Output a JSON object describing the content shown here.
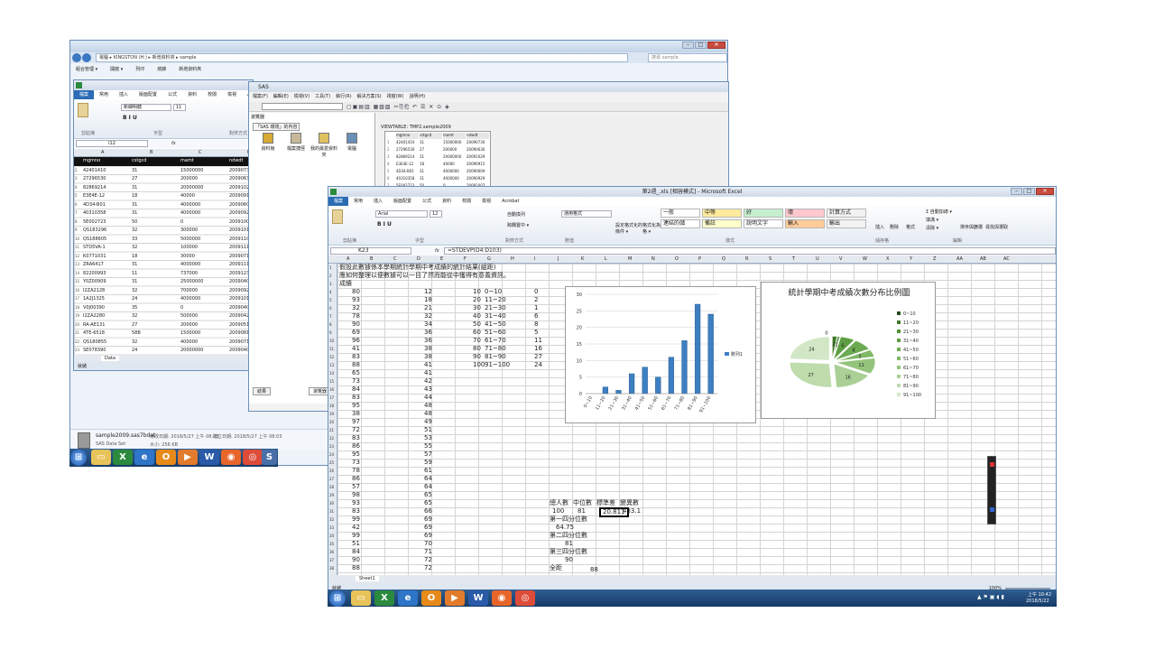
{
  "explorer": {
    "address": "電腦 ▸ KINGSTON (H:) ▸ 新增資料夾 ▸ sample",
    "search_placeholder": "搜尋 sample",
    "toolbar": [
      "組合管理 ▾",
      "開啟 ▾",
      "列印",
      "燒錄",
      "新增資料夾"
    ],
    "file": {
      "name": "sample2009.sas7bdat",
      "modified": "修改日期: 2018/5/27 上午 08:03",
      "created": "建立日期: 2018/5/27 上午 08:03",
      "type": "SAS Data Set",
      "size": "大小: 256 KB"
    }
  },
  "excel1": {
    "tabs": [
      "檔案",
      "常用",
      "插入",
      "版面配置",
      "公式",
      "資料",
      "校閱",
      "檢視",
      "Acrobat"
    ],
    "font": "新細明體",
    "size": "11",
    "cellref": "I12",
    "groups": [
      "剪貼簿",
      "字型",
      "對齊方式"
    ],
    "headers": [
      "mgmno",
      "cstgcd",
      "mamt",
      "ndwdt"
    ],
    "cols": [
      "A",
      "B",
      "C",
      "D"
    ],
    "rows": [
      [
        "42401410",
        "31",
        "15000000",
        "20090730"
      ],
      [
        "27296530",
        "27",
        "200000",
        "20090630"
      ],
      [
        "82869214",
        "31",
        "20000000",
        "20091029"
      ],
      [
        "E3E4E-12",
        "18",
        "40000",
        "20090915"
      ],
      [
        "4D34-B01",
        "31",
        "4000000",
        "20090609"
      ],
      [
        "40310358",
        "31",
        "4000000",
        "20090929"
      ],
      [
        "5E002723",
        "50",
        "0",
        "20091007"
      ],
      [
        "QS183296",
        "32",
        "300000",
        "20091012"
      ],
      [
        "QS188605",
        "33",
        "5000000",
        "20091102"
      ],
      [
        "STD5VA-1",
        "32",
        "100000",
        "20091111"
      ],
      [
        "K0771031",
        "18",
        "30000",
        "20090716"
      ],
      [
        "ZRA6417",
        "31",
        "4000000",
        "20091117"
      ],
      [
        "82200993",
        "11",
        "737000",
        "20091231"
      ],
      [
        "Y0Z00909",
        "31",
        "25000000",
        "20090403"
      ],
      [
        "I2ZA2128",
        "32",
        "700000",
        "20090928"
      ],
      [
        "1A2J1325",
        "24",
        "4000000",
        "20091014"
      ],
      [
        "V0J00390",
        "35",
        "0",
        "20090402"
      ],
      [
        "I2ZA2280",
        "32",
        "500000",
        "20090423"
      ],
      [
        "RA-AE131",
        "27",
        "200000",
        "20090515"
      ],
      [
        "4TE-6518",
        "58B",
        "1500000",
        "20090812"
      ],
      [
        "QS180855",
        "32",
        "400000",
        "20090716"
      ],
      [
        "SE078390",
        "24",
        "20000000",
        "20090402"
      ],
      [
        "CO130950",
        "31",
        "0",
        "20090514"
      ]
    ],
    "sheet": "Data",
    "status": "就緒"
  },
  "sas": {
    "title": "SAS",
    "menus": [
      "檔案(F)",
      "編輯(E)",
      "檢視(V)",
      "工具(T)",
      "執行(R)",
      "解決方案(S)",
      "視窗(W)",
      "說明(H)"
    ],
    "explorer_title": "瀏覽器",
    "explorer_sub": "「SAS 環境」的內容",
    "icons": [
      "資料館",
      "檔案捷徑",
      "我的最愛資料夾",
      "電腦"
    ],
    "viewtable": "VIEWTABLE: TMP2.sample2009",
    "vt_headers": [
      "mgmno",
      "cstgcd",
      "mamt",
      "ndwdt"
    ],
    "vt_rows": [
      [
        "42401410",
        "31",
        "15000000",
        "20090730"
      ],
      [
        "27296530",
        "27",
        "200000",
        "20090630"
      ],
      [
        "82869214",
        "31",
        "20000000",
        "20091029"
      ],
      [
        "E3E4E-12",
        "18",
        "40000",
        "20090915"
      ],
      [
        "4D34-B01",
        "31",
        "4000000",
        "20090609"
      ],
      [
        "40310358",
        "31",
        "4000000",
        "20090929"
      ],
      [
        "5E002723",
        "50",
        "0",
        "20091007"
      ]
    ],
    "results_tab": "結果",
    "explorer_tab": "瀏覽器"
  },
  "excel2": {
    "title": "第2週_.xls [相容模式] - Microsoft Excel",
    "tabs": [
      "檔案",
      "常用",
      "插入",
      "版面配置",
      "公式",
      "資料",
      "校閱",
      "檢視",
      "Acrobat"
    ],
    "font": "Arial",
    "size": "12",
    "cellref": "K23",
    "formula": "=STDEVP(D4:D103)",
    "wrap": "自動換列",
    "merge": "跨欄置中 ▾",
    "numfmt": "通用格式",
    "styles": [
      "一般",
      "中等",
      "好",
      "壞",
      "計算方式",
      "連結的儲",
      "備註",
      "說明文字",
      "輸入",
      "輸出"
    ],
    "styles_colors": [
      "#ffffff",
      "#ffeb9c",
      "#c6efce",
      "#ffc7ce",
      "#f2f2f2",
      "#ffffff",
      "#ffffcc",
      "#ffffff",
      "#ffcc99",
      "#f2f2f2"
    ],
    "groups": [
      "剪貼簿",
      "字型",
      "對齊方式",
      "數值",
      "樣式",
      "儲存格",
      "編輯"
    ],
    "cond": [
      "設定格式化的條件 ▾",
      "格式化為表格 ▾"
    ],
    "cells_btns": [
      "插入",
      "刪除",
      "格式"
    ],
    "edit_btns": [
      "Σ 自動加總 ▾",
      "填滿 ▾",
      "清除 ▾"
    ],
    "sort": "排序與篩選",
    "find": "尋找與選取",
    "cols": [
      "A",
      "B",
      "C",
      "D",
      "E",
      "F",
      "G",
      "H",
      "I",
      "J",
      "K",
      "L",
      "M",
      "N",
      "O",
      "P",
      "Q",
      "R",
      "S",
      "T",
      "U",
      "V",
      "W",
      "X",
      "Y",
      "Z",
      "AA",
      "AB",
      "AC"
    ],
    "line1": "假設此數據係本學期統計學期中考成績的統計結果(組距)",
    "line2": "應如何整理以便數據可以一目了然而能從中獲得有意義資訊。",
    "line3": "成績",
    "colA": [
      "80",
      "93",
      "32",
      "78",
      "90",
      "69",
      "96",
      "41",
      "83",
      "88",
      "65",
      "73",
      "84",
      "83",
      "95",
      "38",
      "97",
      "72",
      "83",
      "86",
      "95",
      "73",
      "78",
      "86",
      "57",
      "98",
      "93",
      "83",
      "99",
      "42",
      "99",
      "51",
      "84",
      "90",
      "88",
      "69"
    ],
    "colD": [
      "12",
      "18",
      "21",
      "32",
      "34",
      "36",
      "36",
      "38",
      "38",
      "41",
      "41",
      "42",
      "43",
      "44",
      "48",
      "48",
      "49",
      "51",
      "53",
      "55",
      "57",
      "59",
      "61",
      "64",
      "64",
      "65",
      "65",
      "66",
      "69",
      "69",
      "69",
      "70",
      "71",
      "72",
      "72",
      "73"
    ],
    "freq_table": [
      [
        "10",
        "0~10",
        "0"
      ],
      [
        "20",
        "11~20",
        "2"
      ],
      [
        "30",
        "21~30",
        "1"
      ],
      [
        "40",
        "31~40",
        "6"
      ],
      [
        "50",
        "41~50",
        "8"
      ],
      [
        "60",
        "51~60",
        "5"
      ],
      [
        "70",
        "61~70",
        "11"
      ],
      [
        "80",
        "71~80",
        "16"
      ],
      [
        "90",
        "81~90",
        "27"
      ],
      [
        "100",
        "91~100",
        "24"
      ]
    ],
    "stats_headers": [
      "總人數",
      "中位數",
      "標準差",
      "變異數"
    ],
    "stats_values": [
      "100",
      "81",
      "20.811",
      "433.1"
    ],
    "q1_label": "第一四分位數",
    "q1": "64.75",
    "q2_label": "第二四分位數",
    "q2": "81",
    "q3_label": "第三四分位數",
    "q3": "90",
    "range_label": "全距",
    "range": "88",
    "sheet": "Sheet1",
    "status": "就緒",
    "zoom": "100%"
  },
  "chart_data": [
    {
      "type": "bar",
      "categories": [
        "0~10",
        "11~20",
        "21~30",
        "31~40",
        "41~50",
        "51~60",
        "61~70",
        "71~80",
        "81~90",
        "91~100"
      ],
      "series": [
        {
          "name": "數列1",
          "values": [
            0,
            2,
            1,
            6,
            8,
            5,
            11,
            16,
            27,
            24
          ]
        }
      ],
      "ylim": [
        0,
        30
      ],
      "yticks": [
        0,
        5,
        10,
        15,
        20,
        25,
        30
      ],
      "legend": "right",
      "color": "#3d7fc1"
    },
    {
      "type": "pie",
      "title": "統計學期中考成績次數分布比例圖",
      "categories": [
        "0~10",
        "11~20",
        "21~30",
        "31~40",
        "41~50",
        "51~60",
        "61~70",
        "71~80",
        "81~90",
        "91~100"
      ],
      "values": [
        0,
        2,
        1,
        6,
        8,
        5,
        11,
        16,
        27,
        24
      ],
      "labels": [
        "0",
        "2",
        "1",
        "6",
        "8",
        "5",
        "11",
        "16",
        "27",
        "24"
      ],
      "colors": [
        "#264d1a",
        "#3f7a2a",
        "#4f8f35",
        "#5e9e42",
        "#6dab52",
        "#80b866",
        "#95c47d",
        "#aad095",
        "#bedcac",
        "#d2e7c6"
      ],
      "legend": "right"
    }
  ],
  "taskbar2": {
    "time": "上午 10:42",
    "date": "2018/5/22"
  }
}
